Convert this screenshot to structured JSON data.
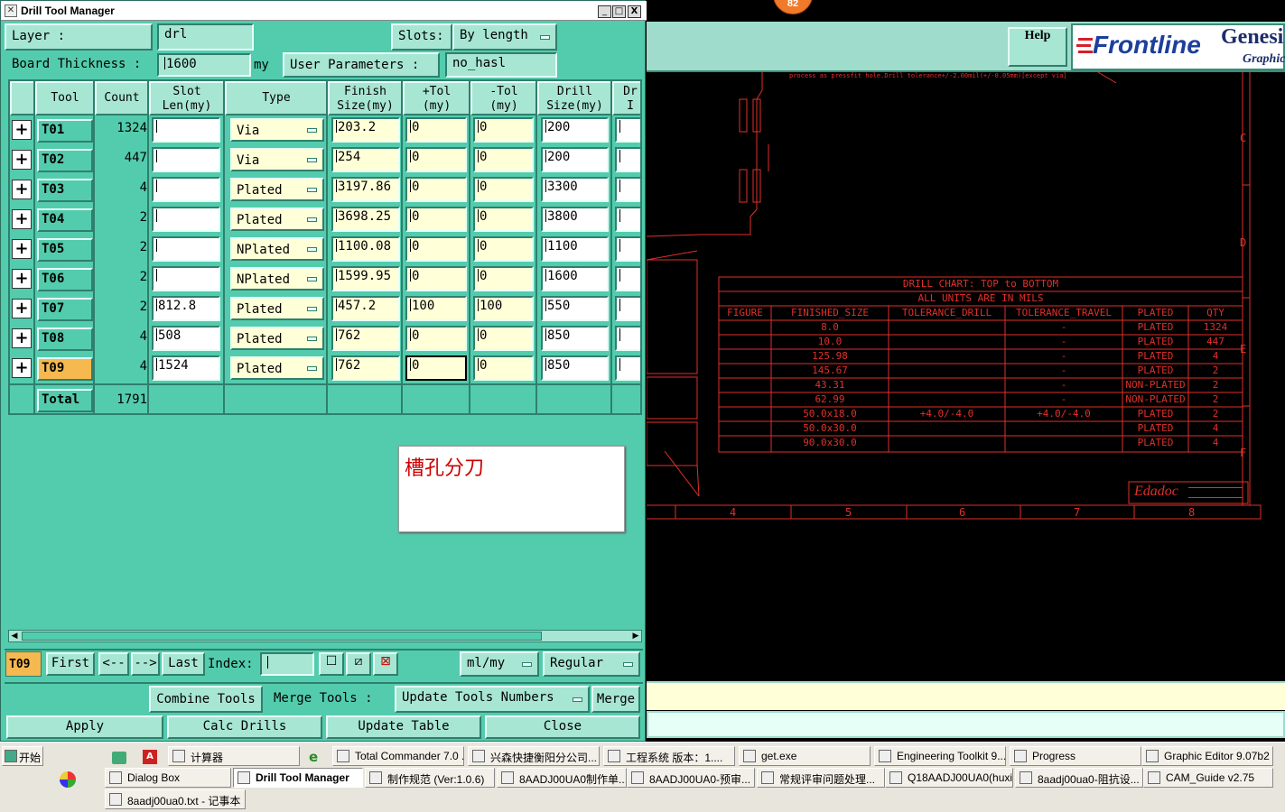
{
  "dialog": {
    "title": "Drill Tool Manager",
    "window_buttons": {
      "minimize": "_",
      "maximize": "□",
      "close": "X"
    },
    "layer_label": "Layer          :",
    "layer_value": "drl",
    "slots_label": "Slots:",
    "slots_value": "By length",
    "board_thickness_label": "Board Thickness :",
    "board_thickness_value": "1600",
    "board_thickness_unit": "my",
    "user_params_label": "User Parameters :",
    "user_params_value": "no_hasl"
  },
  "table": {
    "columns": [
      "Tool",
      "Count",
      "Slot\nLen(my)",
      "Type",
      "Finish\nSize(my)",
      "+Tol\n(my)",
      "-Tol\n(my)",
      "Drill\nSize(my)",
      "Dr\nI"
    ],
    "rows": [
      {
        "tool": "T01",
        "count": "1324",
        "slot": "",
        "type": "Via",
        "finish": "203.2",
        "ptol": "0",
        "ntol": "0",
        "drill": "200"
      },
      {
        "tool": "T02",
        "count": "447",
        "slot": "",
        "type": "Via",
        "finish": "254",
        "ptol": "0",
        "ntol": "0",
        "drill": "200"
      },
      {
        "tool": "T03",
        "count": "4",
        "slot": "",
        "type": "Plated",
        "finish": "3197.86",
        "ptol": "0",
        "ntol": "0",
        "drill": "3300"
      },
      {
        "tool": "T04",
        "count": "2",
        "slot": "",
        "type": "Plated",
        "finish": "3698.25",
        "ptol": "0",
        "ntol": "0",
        "drill": "3800"
      },
      {
        "tool": "T05",
        "count": "2",
        "slot": "",
        "type": "NPlated",
        "finish": "1100.08",
        "ptol": "0",
        "ntol": "0",
        "drill": "1100"
      },
      {
        "tool": "T06",
        "count": "2",
        "slot": "",
        "type": "NPlated",
        "finish": "1599.95",
        "ptol": "0",
        "ntol": "0",
        "drill": "1600"
      },
      {
        "tool": "T07",
        "count": "2",
        "slot": "812.8",
        "type": "Plated",
        "finish": "457.2",
        "ptol": "100",
        "ntol": "100",
        "drill": "550"
      },
      {
        "tool": "T08",
        "count": "4",
        "slot": "508",
        "type": "Plated",
        "finish": "762",
        "ptol": "0",
        "ntol": "0",
        "drill": "850"
      },
      {
        "tool": "T09",
        "count": "4",
        "slot": "1524",
        "type": "Plated",
        "finish": "762",
        "ptol": "0",
        "ntol": "0",
        "drill": "850"
      }
    ],
    "total_label": "Total",
    "total_value": "1791",
    "selected_tool": "T09"
  },
  "note": "槽孔分刀",
  "nav": {
    "current": "T09",
    "first": "First",
    "prev": "<--",
    "next": "-->",
    "last": "Last",
    "index_label": "Index:",
    "units": "ml/my",
    "mode": "Regular"
  },
  "actions": {
    "combine": "Combine Tools",
    "merge_label": "Merge Tools :",
    "merge_option": "Update Tools Numbers",
    "merge": "Merge",
    "apply": "Apply",
    "calc": "Calc Drills",
    "update": "Update Table",
    "close": "Close"
  },
  "cad": {
    "help": "Help",
    "brand": "Frontline",
    "product": "Genesi",
    "product_sub": "Graphic",
    "badge": "82",
    "top_note": "process as pressfit hole.Drill tolerance+/-2.00mil(+/-0.05mm)[except via]",
    "chart_title": "DRILL CHART: TOP to BOTTOM",
    "chart_units": "ALL UNITS ARE IN MILS",
    "chart_headers": [
      "FIGURE",
      "FINISHED_SIZE",
      "TOLERANCE_DRILL",
      "TOLERANCE_TRAVEL",
      "PLATED",
      "QTY"
    ],
    "chart_rows": [
      [
        "",
        "8.0",
        "",
        "-",
        "PLATED",
        "1324"
      ],
      [
        "",
        "10.0",
        "",
        "-",
        "PLATED",
        "447"
      ],
      [
        "",
        "125.98",
        "",
        "-",
        "PLATED",
        "4"
      ],
      [
        "",
        "145.67",
        "",
        "-",
        "PLATED",
        "2"
      ],
      [
        "",
        "43.31",
        "",
        "-",
        "NON-PLATED",
        "2"
      ],
      [
        "",
        "62.99",
        "",
        "-",
        "NON-PLATED",
        "2"
      ],
      [
        "",
        "50.0x18.0",
        "+4.0/-4.0",
        "+4.0/-4.0",
        "PLATED",
        "2"
      ],
      [
        "",
        "50.0x30.0",
        "",
        "",
        "PLATED",
        "4"
      ],
      [
        "",
        "90.0x30.0",
        "",
        "",
        "PLATED",
        "4"
      ]
    ],
    "ruler": [
      "4",
      "5",
      "6",
      "7",
      "8"
    ],
    "side_letters": [
      "C",
      "D",
      "E",
      "F"
    ],
    "logo": "Edadoc"
  },
  "taskbar": {
    "start": "开始",
    "row1": [
      {
        "label": "计算器"
      },
      {
        "label": "Total Commander 7.0 ..."
      },
      {
        "label": "兴森快捷衡阳分公司..."
      },
      {
        "label": "工程系统  版本：1...."
      },
      {
        "label": "get.exe"
      },
      {
        "label": "Engineering Toolkit 9...."
      },
      {
        "label": "Progress"
      },
      {
        "label": "Graphic Editor 9.07b2 ..."
      }
    ],
    "row2": [
      {
        "label": "Dialog Box"
      },
      {
        "label": "Drill Tool Manager"
      },
      {
        "label": "制作规范 (Ver:1.0.6)"
      },
      {
        "label": "8AADJ00UA0制作单..."
      },
      {
        "label": "8AADJ00UA0-预审..."
      },
      {
        "label": "常规评审问题处理..."
      },
      {
        "label": "Q18AADJ00UA0(huxi..."
      },
      {
        "label": "8aadj00ua0-阻抗设..."
      },
      {
        "label": "CAM_Guide v2.75"
      }
    ],
    "row3": [
      {
        "label": "8aadj00ua0.txt - 记事本"
      }
    ]
  }
}
